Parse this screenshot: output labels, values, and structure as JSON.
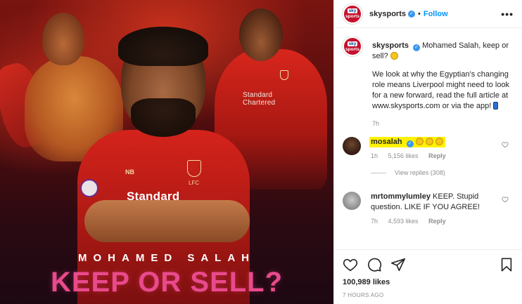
{
  "post": {
    "image": {
      "player_name": "MOHAMED SALAH",
      "headline": "KEEP OR SELL?",
      "shirt_sponsor": "Standard",
      "shirt_sponsor_right": "Standard\nChartered",
      "crest_text": "LFC",
      "kit_brand": "NB"
    },
    "header": {
      "avatar_top": "sky",
      "avatar_bottom": "sports",
      "username": "skysports",
      "separator": "•",
      "follow_label": "Follow",
      "more_icon": "more-horizontal-icon"
    },
    "caption": {
      "username": "skysports",
      "first_line": "Mohamed Salah, keep or sell?",
      "body": "We look at why the Egyptian's changing role means Liverpool might need to look for a new forward, read the full article at www.skysports.com or via the app!",
      "time": "7h"
    },
    "comments": [
      {
        "username": "mosalah",
        "verified": true,
        "text": "",
        "emoji_count": 3,
        "time": "1h",
        "likes": "5,156 likes",
        "reply_label": "Reply",
        "view_replies": "View replies (308)",
        "highlighted": true
      },
      {
        "username": "mrtommylumley",
        "text": "KEEP. Stupid question. LIKE IF YOU AGREE!",
        "time": "7h",
        "likes": "4,593 likes",
        "reply_label": "Reply"
      }
    ],
    "actions": {
      "like_icon": "heart-icon",
      "comment_icon": "comment-icon",
      "share_icon": "paper-plane-icon",
      "save_icon": "bookmark-icon",
      "likes_count": "100,989 likes",
      "posted_time": "7 HOURS AGO"
    },
    "colors": {
      "sky_red": "#c8102e",
      "follow_blue": "#0095f6",
      "verified_blue": "#3897f0",
      "highlight_yellow": "#fff200",
      "headline_pink": "#e94a8c"
    }
  }
}
